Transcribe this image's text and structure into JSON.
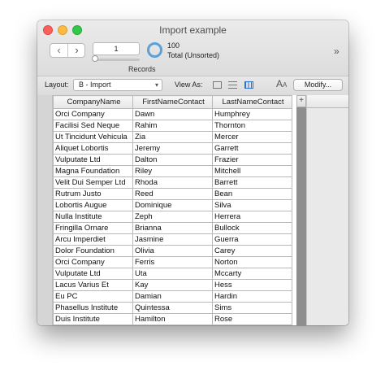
{
  "window": {
    "title": "Import example"
  },
  "toolbar": {
    "record_value": "1",
    "record_count": "100",
    "found_status": "Total (Unsorted)",
    "records_label": "Records",
    "overflow_label": "»"
  },
  "layout_bar": {
    "layout_label": "Layout:",
    "layout_value": "B - Import",
    "view_as_label": "View As:",
    "modify_label": "Modify..."
  },
  "icons": [
    "prev-record-icon",
    "next-record-icon",
    "pie-chart-icon",
    "form-view-icon",
    "list-view-icon",
    "table-view-icon",
    "font-size-icon",
    "chevron-down-icon"
  ],
  "colors": {
    "accent": "#2c6fd4",
    "pie": "#5ba0d8",
    "gutter": "#8e8e8e"
  },
  "table": {
    "columns": [
      "CompanyName",
      "FirstNameContact",
      "LastNameContact"
    ],
    "add_column_label": "+",
    "rows": [
      [
        "Orci Company",
        "Dawn",
        "Humphrey"
      ],
      [
        "Facilisi Sed Neque",
        "Rahim",
        "Thornton"
      ],
      [
        "Ut Tincidunt Vehicula",
        "Zia",
        "Mercer"
      ],
      [
        "Aliquet Lobortis",
        "Jeremy",
        "Garrett"
      ],
      [
        "Vulputate Ltd",
        "Dalton",
        "Frazier"
      ],
      [
        "Magna Foundation",
        "Riley",
        "Mitchell"
      ],
      [
        "Velit Dui Semper Ltd",
        "Rhoda",
        "Barrett"
      ],
      [
        "Rutrum Justo",
        "Reed",
        "Bean"
      ],
      [
        "Lobortis Augue",
        "Dominique",
        "Silva"
      ],
      [
        "Nulla Institute",
        "Zeph",
        "Herrera"
      ],
      [
        "Fringilla Ornare",
        "Brianna",
        "Bullock"
      ],
      [
        "Arcu Imperdiet",
        "Jasmine",
        "Guerra"
      ],
      [
        "Dolor Foundation",
        "Olivia",
        "Carey"
      ],
      [
        "Orci Company",
        "Ferris",
        "Norton"
      ],
      [
        "Vulputate Ltd",
        "Uta",
        "Mccarty"
      ],
      [
        "Lacus Varius Et",
        "Kay",
        "Hess"
      ],
      [
        "Eu PC",
        "Damian",
        "Hardin"
      ],
      [
        "Phasellus Institute",
        "Quintessa",
        "Sims"
      ],
      [
        "Duis Institute",
        "Hamilton",
        "Rose"
      ]
    ]
  }
}
